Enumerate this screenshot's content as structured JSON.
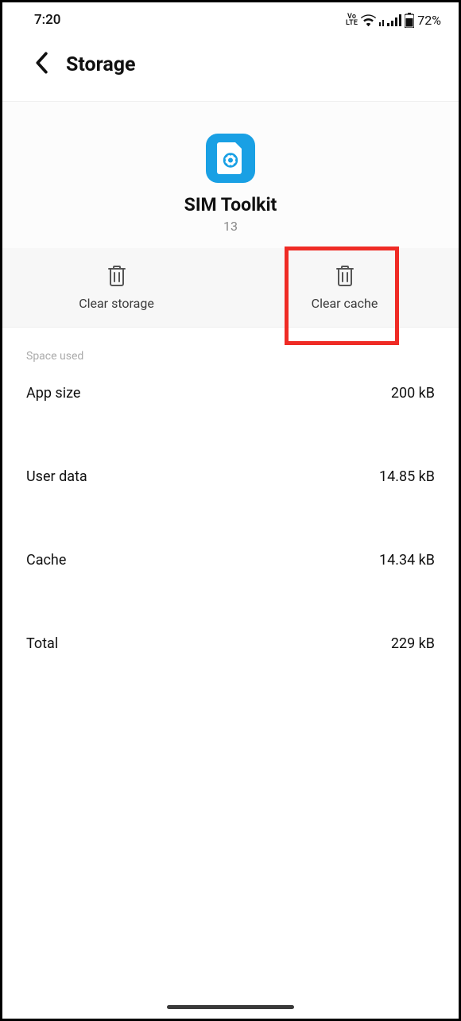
{
  "status": {
    "time": "7:20",
    "volte": "Vo\nLTE",
    "battery": "72%"
  },
  "header": {
    "title": "Storage"
  },
  "app": {
    "name": "SIM Toolkit",
    "version": "13"
  },
  "actions": {
    "clear_storage": "Clear storage",
    "clear_cache": "Clear cache"
  },
  "section": {
    "title": "Space used"
  },
  "rows": {
    "app_size_label": "App size",
    "app_size_value": "200 kB",
    "user_data_label": "User data",
    "user_data_value": "14.85 kB",
    "cache_label": "Cache",
    "cache_value": "14.34 kB",
    "total_label": "Total",
    "total_value": "229 kB"
  }
}
